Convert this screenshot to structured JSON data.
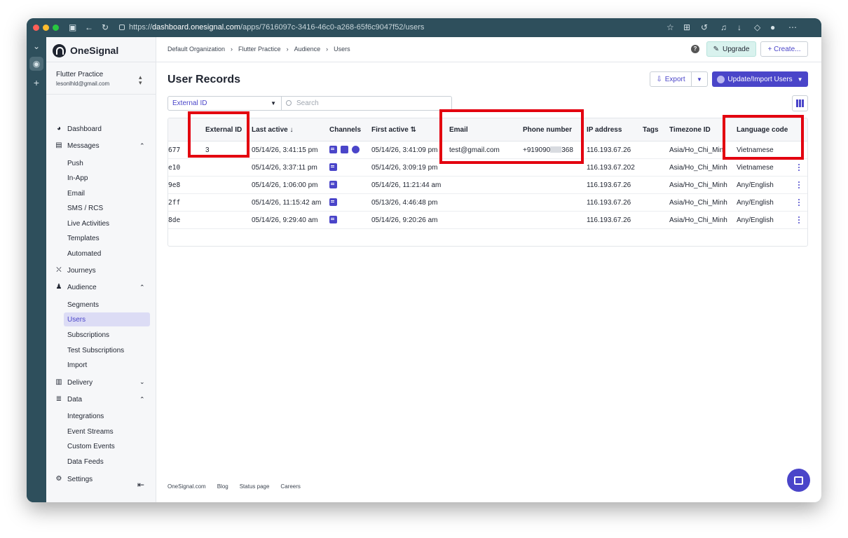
{
  "browser": {
    "url_scheme": "https://",
    "url_host": "dashboard.onesignal.com",
    "url_path": "/apps/7616097c-3416-46c0-a268-65f6c9047f52/users"
  },
  "sidebar": {
    "brand": "OneSignal",
    "app_name": "Flutter Practice",
    "account_email": "lesonlhld@gmail.com",
    "nav": {
      "dashboard": "Dashboard",
      "messages": "Messages",
      "journeys": "Journeys",
      "audience": "Audience",
      "delivery": "Delivery",
      "data": "Data",
      "settings": "Settings"
    },
    "messages_sub": [
      "Push",
      "In-App",
      "Email",
      "SMS / RCS",
      "Live Activities",
      "Templates",
      "Automated"
    ],
    "audience_sub": [
      "Segments",
      "Users",
      "Subscriptions",
      "Test Subscriptions",
      "Import"
    ],
    "data_sub": [
      "Integrations",
      "Event Streams",
      "Custom Events",
      "Data Feeds"
    ]
  },
  "topbar": {
    "breadcrumb": [
      "Default Organization",
      "Flutter Practice",
      "Audience",
      "Users"
    ],
    "upgrade_label": "Upgrade",
    "create_label": "+ Create..."
  },
  "page": {
    "title": "User Records",
    "export_label": "Export",
    "import_label": "Update/Import Users",
    "filter_value": "External ID",
    "search_placeholder": "Search"
  },
  "table": {
    "headers": {
      "external_id": "External ID",
      "last_active": "Last active ↓",
      "channels": "Channels",
      "first_active": "First active ⇅",
      "email": "Email",
      "phone": "Phone number",
      "ip": "IP address",
      "tags": "Tags",
      "timezone": "Timezone ID",
      "language": "Language code"
    },
    "rows": [
      {
        "id_suffix": "677",
        "external_id": "3",
        "last_active": "05/14/26, 3:41:15 pm",
        "first_active": "05/14/26, 3:41:09 pm",
        "email": "test@gmail.com",
        "phone_start": "+919090",
        "phone_end": "368",
        "ip": "116.193.67.26",
        "timezone": "Asia/Ho_Chi_Minh",
        "language": "Vietnamese"
      },
      {
        "id_suffix": "e10",
        "external_id": "",
        "last_active": "05/14/26, 3:37:11 pm",
        "first_active": "05/14/26, 3:09:19 pm",
        "email": "",
        "ip": "116.193.67.202",
        "timezone": "Asia/Ho_Chi_Minh",
        "language": "Vietnamese"
      },
      {
        "id_suffix": "9e8",
        "external_id": "",
        "last_active": "05/14/26, 1:06:00 pm",
        "first_active": "05/14/26, 11:21:44 am",
        "email": "",
        "ip": "116.193.67.26",
        "timezone": "Asia/Ho_Chi_Minh",
        "language": "Any/English"
      },
      {
        "id_suffix": "2ff",
        "external_id": "",
        "last_active": "05/14/26, 11:15:42 am",
        "first_active": "05/13/26, 4:46:48 pm",
        "email": "",
        "ip": "116.193.67.26",
        "timezone": "Asia/Ho_Chi_Minh",
        "language": "Any/English"
      },
      {
        "id_suffix": "8de",
        "external_id": "",
        "last_active": "05/14/26, 9:29:40 am",
        "first_active": "05/14/26, 9:20:26 am",
        "email": "",
        "ip": "116.193.67.26",
        "timezone": "Asia/Ho_Chi_Minh",
        "language": "Any/English"
      }
    ]
  },
  "footer": [
    "OneSignal.com",
    "Blog",
    "Status page",
    "Careers"
  ],
  "colors": {
    "accent": "#4a45c9",
    "highlight": "#e3000f",
    "chrome": "#2e4f5c"
  }
}
